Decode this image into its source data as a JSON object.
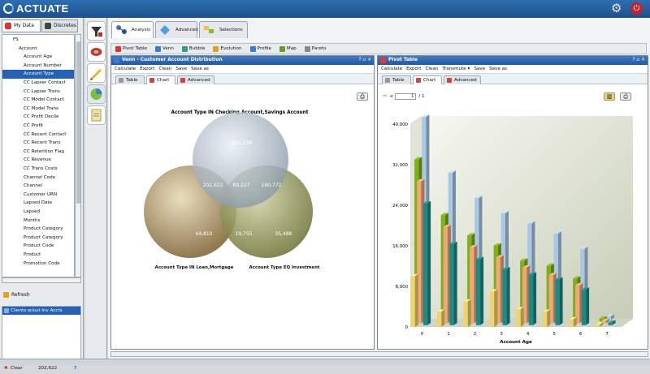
{
  "app": {
    "logo_text": "ACTUATE"
  },
  "left_panel": {
    "tabs": [
      {
        "label": "My Data"
      },
      {
        "label": "Discretes"
      }
    ],
    "tree": [
      {
        "label": "FS",
        "level": 0,
        "type": "db"
      },
      {
        "label": "Account",
        "level": 1,
        "type": "table"
      },
      {
        "label": "Account Age",
        "level": 2
      },
      {
        "label": "Account Number",
        "level": 2
      },
      {
        "label": "Account Type",
        "level": 2,
        "selected": true
      },
      {
        "label": "CC Lapser Contact",
        "level": 2
      },
      {
        "label": "CC Lapser Trans",
        "level": 2
      },
      {
        "label": "CC Model Contact",
        "level": 2
      },
      {
        "label": "CC Model Trans",
        "level": 2
      },
      {
        "label": "CC Profit Decile",
        "level": 2
      },
      {
        "label": "CC Profit",
        "level": 2
      },
      {
        "label": "CC Recent Contact",
        "level": 2
      },
      {
        "label": "CC Recent Trans",
        "level": 2
      },
      {
        "label": "CC Retention Flag",
        "level": 2
      },
      {
        "label": "CC Revenue",
        "level": 2
      },
      {
        "label": "CC Trans Costs",
        "level": 2
      },
      {
        "label": "Channel Code",
        "level": 2
      },
      {
        "label": "Channel",
        "level": 2
      },
      {
        "label": "Customer URN",
        "level": 2
      },
      {
        "label": "Lapsed Date",
        "level": 2
      },
      {
        "label": "Lapsed",
        "level": 2
      },
      {
        "label": "Months",
        "level": 2
      },
      {
        "label": "Product Category",
        "level": 2
      },
      {
        "label": "Product Category",
        "level": 2
      },
      {
        "label": "Product Code",
        "level": 2
      },
      {
        "label": "Product",
        "level": 2
      },
      {
        "label": "Promotion Code",
        "level": 2
      }
    ],
    "refresh_label": "Refresh",
    "filter_item": "Clients w/out Inv Accts",
    "clear_label": "Clear",
    "count": "202,622",
    "help": "?"
  },
  "main_tabs": [
    {
      "label": "Analysis",
      "active": true
    },
    {
      "label": "Advanced"
    },
    {
      "label": "Selections"
    }
  ],
  "toolbar": [
    {
      "label": "Pivot Table",
      "color": "#d33"
    },
    {
      "label": "Venn",
      "color": "#3a7bd5"
    },
    {
      "label": "Bubble",
      "color": "#2a9d8f"
    },
    {
      "label": "Evolution",
      "color": "#e6a11c"
    },
    {
      "label": "Profile",
      "color": "#3a7bd5"
    },
    {
      "label": "Map",
      "color": "#6a9c2a"
    },
    {
      "label": "Pareto",
      "color": "#888"
    }
  ],
  "venn_window": {
    "title": "Venn - Customer Account Distribution",
    "controls": "? ▫ ×",
    "menu": [
      "Calculate",
      "Export",
      "Clean",
      "Save",
      "Save as"
    ],
    "tabs": [
      {
        "label": "Table"
      },
      {
        "label": "Chart",
        "active": true
      },
      {
        "label": "Advanced"
      }
    ],
    "chart_title": "Account Type IN Checking Account,Savings Account",
    "label_b": "Account Type IN Loan,Mortgage",
    "label_c": "Account Type EQ Investment",
    "values": {
      "a_only": "431,236",
      "ab": "202,622",
      "abc": "89,227",
      "ac": "160,772",
      "b_only": "44,810",
      "bc": "19,755",
      "c_only": "35,488"
    }
  },
  "pivot_window": {
    "title": "Pivot Table",
    "controls": "? ▫ ×",
    "menu": [
      "Calculate",
      "Export",
      "Clean",
      "Transmute ▾",
      "Save",
      "Save as"
    ],
    "tabs": [
      {
        "label": "Table"
      },
      {
        "label": "Chart",
        "active": true
      },
      {
        "label": "Advanced"
      }
    ],
    "pager": {
      "page": "1",
      "total": "/ 1"
    }
  },
  "chart_data": {
    "type": "bar",
    "subtype": "3d-clustered",
    "xlabel": "Account Age",
    "ylabel": "",
    "categories": [
      "0",
      "1",
      "2",
      "3",
      "4",
      "5",
      "6",
      "7"
    ],
    "ylim": [
      0,
      40000
    ],
    "yticks": [
      "0",
      "8,000",
      "16,000",
      "24,000",
      "32,000",
      "40,000"
    ],
    "series": [
      {
        "color": "#f0d36a",
        "values": [
          10000,
          3000,
          5000,
          7000,
          3500,
          3000,
          1500,
          500
        ]
      },
      {
        "color": "#7fb018",
        "values": [
          32000,
          21000,
          17000,
          15000,
          12000,
          11000,
          8500,
          600
        ]
      },
      {
        "color": "#f0a878",
        "values": [
          28000,
          19000,
          15000,
          13000,
          11000,
          9500,
          7500,
          500
        ]
      },
      {
        "color": "#a8c8e6",
        "values": [
          40000,
          29000,
          24000,
          21000,
          19000,
          17000,
          14000,
          700
        ]
      },
      {
        "color": "#1e8a86",
        "values": [
          24000,
          16000,
          13000,
          11000,
          10000,
          9000,
          7000,
          500
        ]
      }
    ]
  }
}
